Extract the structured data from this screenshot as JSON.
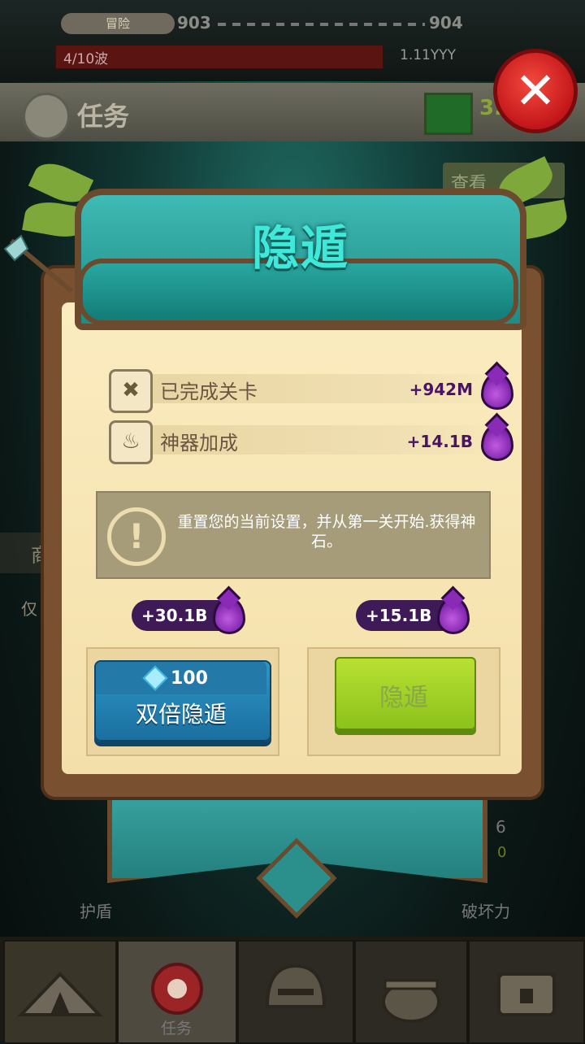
{
  "top": {
    "stage_label": "冒险",
    "current_level": "903",
    "next_level": "904",
    "wave": "4/10波",
    "enemy_hp": "1.11YYY"
  },
  "task_bar": {
    "title": "任务",
    "gem_value": "3.",
    "check_label": "查看"
  },
  "background_partial": {
    "left_label_1": "商",
    "left_label_2": "仅",
    "right_num_1": "6",
    "right_num_2": "0",
    "shield_label": "护盾",
    "breaker_label": "破坏力"
  },
  "dialog": {
    "title": "隐遁",
    "rows": [
      {
        "icon": "map-icon",
        "label": "已完成关卡",
        "value": "+942M"
      },
      {
        "icon": "cauldron-icon",
        "label": "神器加成",
        "value": "+14.1B"
      }
    ],
    "warning": "重置您的当前设置，并从第一关开始.获得神石。",
    "rewards": {
      "double": "+30.1B",
      "single": "+15.1B"
    },
    "double_button": {
      "cost": "100",
      "label": "双倍隐遁"
    },
    "single_button": {
      "label": "隐遁"
    }
  },
  "bottom_nav": {
    "tabs": [
      {
        "name": "home",
        "label": ""
      },
      {
        "name": "tasks",
        "label": "任务"
      },
      {
        "name": "heroes",
        "label": ""
      },
      {
        "name": "artifacts",
        "label": ""
      },
      {
        "name": "chest",
        "label": ""
      }
    ]
  },
  "colors": {
    "accent_teal": "#3fe8d8",
    "essence_purple": "#7a1fa8",
    "close_red": "#d62020",
    "confirm_green": "#9ccc22",
    "double_blue": "#2580b3"
  }
}
